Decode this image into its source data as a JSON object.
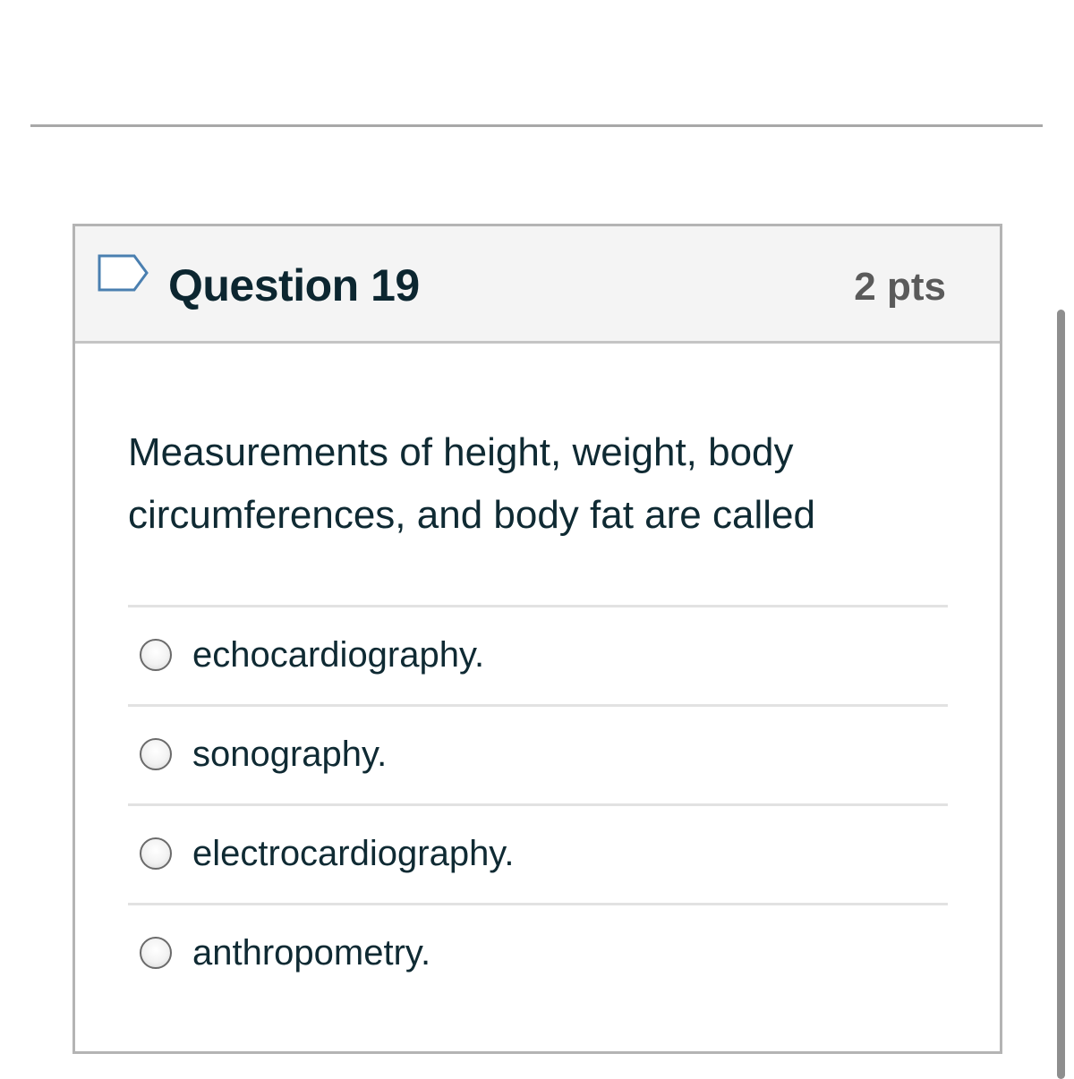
{
  "question": {
    "title": "Question 19",
    "points": "2 pts",
    "flag_icon": "flag-bookmark-icon",
    "text": "Measurements of height, weight, body circumferences, and body fat are called",
    "answers": [
      {
        "label": "echocardiography.",
        "selected": false
      },
      {
        "label": "sonography.",
        "selected": false
      },
      {
        "label": "electrocardiography.",
        "selected": false
      },
      {
        "label": "anthropometry.",
        "selected": false
      }
    ]
  },
  "colors": {
    "text": "#0f2a33",
    "points": "#5a5a5a",
    "header_background": "#f4f4f4",
    "card_border": "#b4b4b4",
    "flag_outline": "#4a7fb0"
  }
}
